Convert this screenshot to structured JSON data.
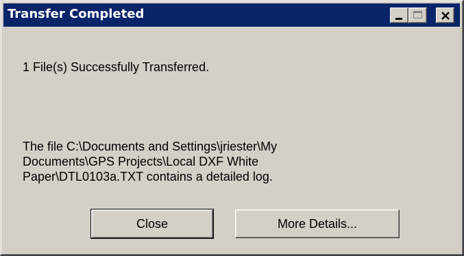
{
  "window": {
    "title": "Transfer Completed",
    "colors": {
      "titlebar": "#0a246a",
      "face": "#d4d0c8"
    }
  },
  "titlebar_buttons": {
    "minimize_icon": "minimize-icon",
    "maximize_icon": "maximize-icon",
    "close_icon": "close-icon"
  },
  "message": {
    "summary": "1 File(s) Successfully Transferred.",
    "log_lines": [
      "The file C:\\Documents and Settings\\jriester\\My",
      "Documents\\GPS Projects\\Local DXF White",
      "Paper\\DTL0103a.TXT contains a detailed log."
    ]
  },
  "buttons": {
    "close_label": "Close",
    "more_details_label": "More Details..."
  }
}
